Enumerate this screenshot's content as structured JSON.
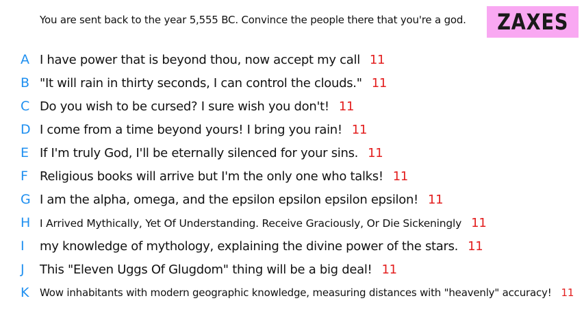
{
  "prompt": "You are sent back to the year 5,555 BC. Convince the people there that you're a god.",
  "badge": "ZAXES",
  "colors": {
    "letter": "#1e8ff0",
    "score": "#e31e1e",
    "badge_bg": "#f9a8f2"
  },
  "answers": [
    {
      "letter": "A",
      "text": "I have power that is beyond thou, now accept my call",
      "score": "11"
    },
    {
      "letter": "B",
      "text": "\"It will rain in thirty seconds, I can control the clouds.\"",
      "score": "11"
    },
    {
      "letter": "C",
      "text": "Do you wish to be cursed? I sure wish you don't!",
      "score": "11"
    },
    {
      "letter": "D",
      "text": "I come from a time beyond yours! I bring you rain!",
      "score": "11"
    },
    {
      "letter": "E",
      "text": "If I'm truly God, I'll be eternally silenced for your sins.",
      "score": "11"
    },
    {
      "letter": "F",
      "text": "Religious books will arrive but I'm the only one who talks!",
      "score": "11"
    },
    {
      "letter": "G",
      "text": "I am the alpha, omega, and the epsilon epsilon epsilon epsilon!",
      "score": "11"
    },
    {
      "letter": "H",
      "text": "I Arrived Mythically, Yet Of Understanding. Receive Graciously, Or Die Sickeningly",
      "score": "11"
    },
    {
      "letter": "I",
      "text": "my knowledge of mythology, explaining the divine power of the stars.",
      "score": "11"
    },
    {
      "letter": "J",
      "text": "This \"Eleven Uggs Of Glugdom\" thing will be a big deal!",
      "score": "11"
    },
    {
      "letter": "K",
      "text": "Wow inhabitants with modern geographic knowledge, measuring distances with \"heavenly\" accuracy!",
      "score": "11"
    }
  ]
}
